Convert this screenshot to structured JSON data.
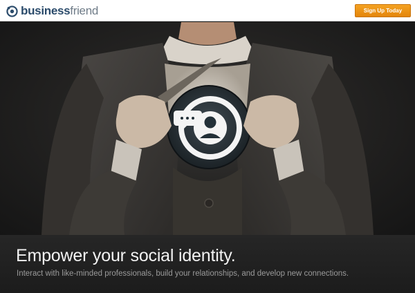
{
  "header": {
    "logo_bold": "business",
    "logo_light": "friend",
    "logo_icon": "businessfriend-logo-icon",
    "signup_label": "Sign Up Today"
  },
  "hero": {
    "image_subject": "man-in-suit-revealing-chat-person-icon",
    "emblem_icon": "chat-person-icon"
  },
  "caption": {
    "headline": "Empower your social identity.",
    "subline": "Interact with like-minded professionals, build your relationships, and develop new connections."
  },
  "colors": {
    "accent": "#f09a1a",
    "brand_dark": "#2b4b6b",
    "caption_bg": "#222222"
  }
}
